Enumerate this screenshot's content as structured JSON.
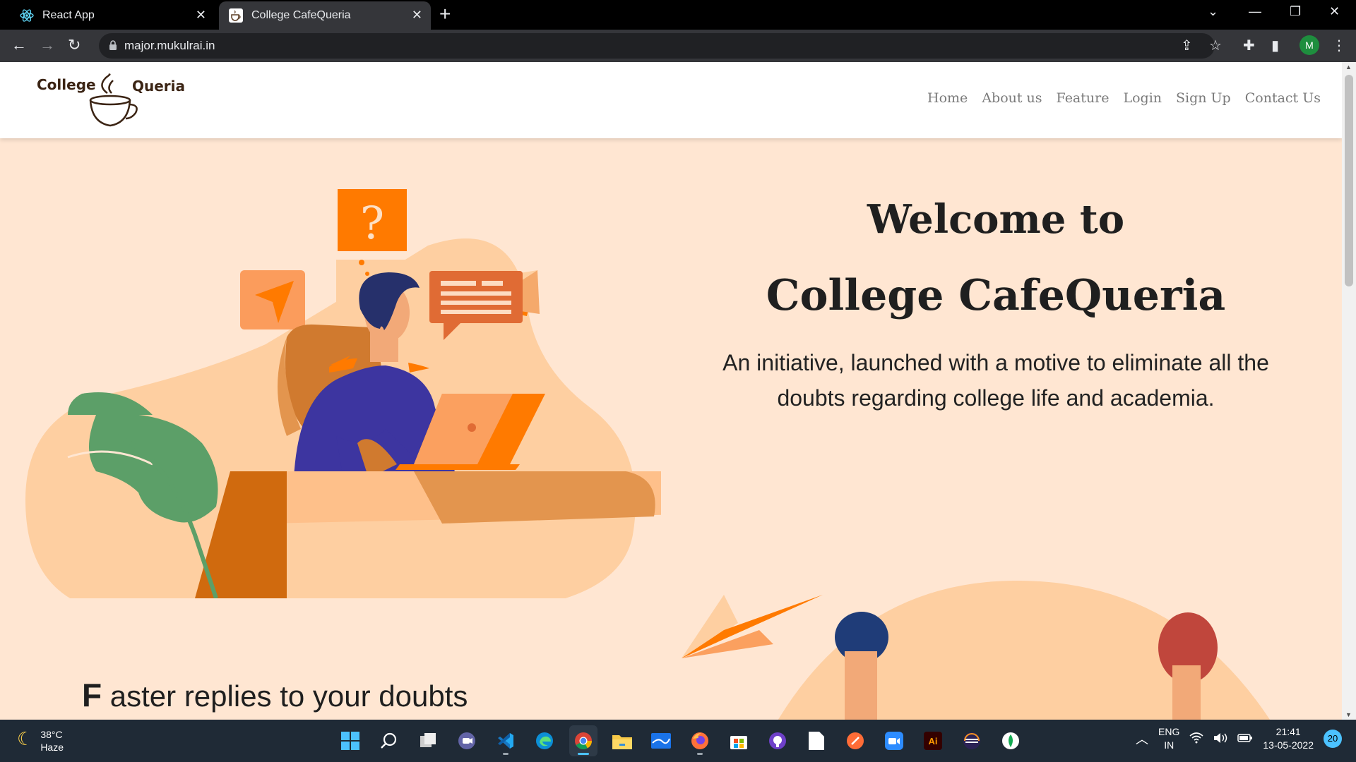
{
  "browser": {
    "tabs": [
      {
        "title": "React App",
        "favicon": "react-icon"
      },
      {
        "title": "College CafeQueria",
        "favicon": "cup-icon",
        "active": true
      }
    ],
    "url": "major.mukulrai.in",
    "profile_initial": "M"
  },
  "site": {
    "logo": {
      "word1": "College",
      "word2": "Queria"
    },
    "nav": [
      "Home",
      "About us",
      "Feature",
      "Login",
      "Sign Up",
      "Contact Us"
    ],
    "hero": {
      "title_line1": "Welcome to",
      "title_line2": "College CafeQueria",
      "tagline": "An initiative, launched with a motive to eliminate all the doubts regarding college life and academia."
    },
    "section2": {
      "first_letter": "F",
      "rest": "aster replies to your doubts"
    }
  },
  "taskbar": {
    "weather": {
      "temp": "38°C",
      "condition": "Haze"
    },
    "apps": [
      "start-icon",
      "search-icon",
      "task-view-icon",
      "chat-icon",
      "vscode-icon",
      "edge-icon",
      "chrome-icon",
      "file-explorer-icon",
      "mail-icon",
      "firefox-icon",
      "store-icon",
      "github-icon",
      "notepad-icon",
      "postman-icon",
      "zoom-icon",
      "illustrator-icon",
      "eclipse-icon",
      "mongodb-icon"
    ],
    "language": {
      "line1": "ENG",
      "line2": "IN"
    },
    "time": "21:41",
    "date": "13-05-2022",
    "notifications": "20"
  },
  "colors": {
    "page_bg": "#ffe6d2",
    "accent": "#ff7a00",
    "nav_text": "#7a7a7a"
  }
}
